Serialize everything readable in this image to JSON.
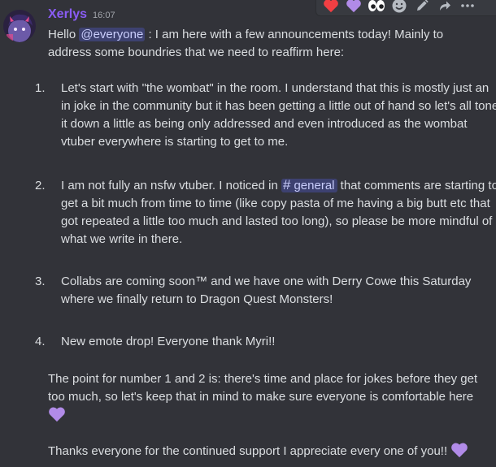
{
  "message": {
    "author": "Xerlys",
    "timestamp": "16:07",
    "intro_prefix": "Hello ",
    "intro_mention": "@everyone",
    "intro_text": " : I am here with a few announcements today! Mainly to address some boundries that we need to reaffirm here:",
    "item1_num": "1.",
    "item1_text": "Let's start with \"the wombat\" in the room. I understand that this is mostly just an in joke in the community but it has been getting a little out of hand so let's all tone it down a little as being only addressed and even introduced as the wombat vtuber everywhere is starting to get to me.",
    "item2_num": "2.",
    "item2_text_before": "I am not fully an nsfw vtuber. I noticed in ",
    "item2_channel_hash": "#",
    "item2_channel": "general",
    "item2_text_after": " that comments are starting to get a bit much from time to time (like copy pasta of me having a big butt etc that got repeated a little too much and lasted too long), so please be more mindful of what we write in there.",
    "item3_num": "3.",
    "item3_text": "Collabs are coming soon™ and we have one with Derry Cowe this Saturday where we finally return to Dragon Quest Monsters!",
    "item4_num": "4.",
    "item4_text": "New emote drop! Everyone thank Myri!!",
    "point_text": "The point for number 1 and 2 is: there's time and place for jokes before they get too much, so let's keep that in mind to make sure everyone is comfortable here ",
    "thanks_text": "Thanks everyone for the continued support I appreciate every one of you!! "
  },
  "toolbar": {
    "icons": [
      "red-heart-reaction",
      "purple-heart-reaction",
      "eyes-reaction",
      "add-reaction",
      "edit",
      "reply",
      "more-options"
    ]
  },
  "colors": {
    "background": "#323339",
    "username": "#8a5cf5",
    "mention_bg": "rgba(88,101,242,0.3)",
    "heart_purple": "#b18be8",
    "heart_red": "#f23f43"
  }
}
